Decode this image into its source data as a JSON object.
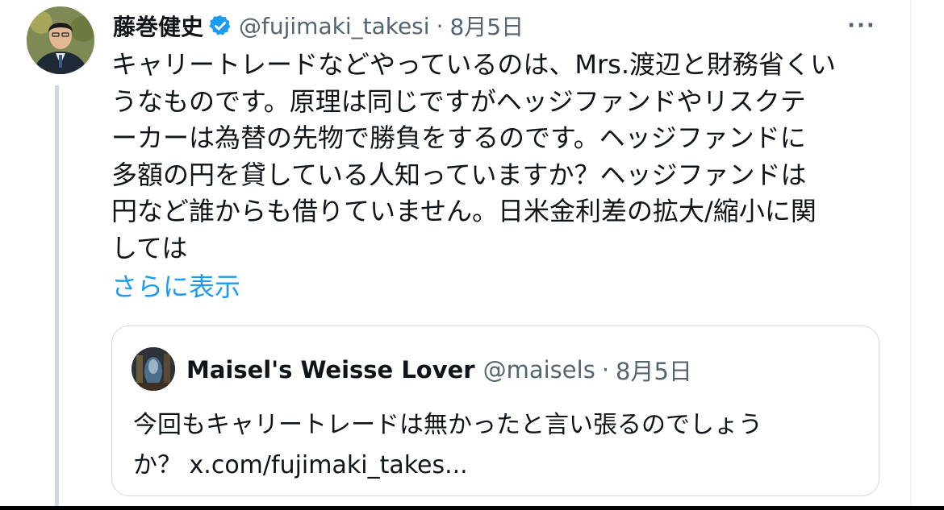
{
  "tweet": {
    "author_name": "藤巻健史",
    "handle": "@fujimaki_takesi",
    "separator": "·",
    "date": "8月5日",
    "more_label": "···",
    "text_lines": [
      "キャリートレードなどやっているのは、Mrs.渡辺と財務省くい",
      "うなものです。原理は同じですがヘッジファンドやリスクテ",
      "ーカーは為替の先物で勝負をするのです。ヘッジファンドに",
      "多額の円を貸している人知っていますか？ヘッジファンドは",
      "円など誰からも借りていません。日米金利差の拡大/縮小に関",
      "しては"
    ],
    "show_more": "さらに表示"
  },
  "quote": {
    "author_name": "Maisel's Weisse Lover",
    "handle": "@maisels",
    "separator": "·",
    "date": "8月5日",
    "text_lines": [
      "今回もキャリートレードは無かったと言い張るのでしょう",
      "か？ x.com/fujimaki_takes..."
    ]
  },
  "colors": {
    "link": "#1d9bf0",
    "verified": "#1d9bf0",
    "secondary_text": "#536471",
    "border": "#cfd9de"
  },
  "icons": {
    "verified": "verified-badge-icon",
    "more": "more-options-icon"
  }
}
